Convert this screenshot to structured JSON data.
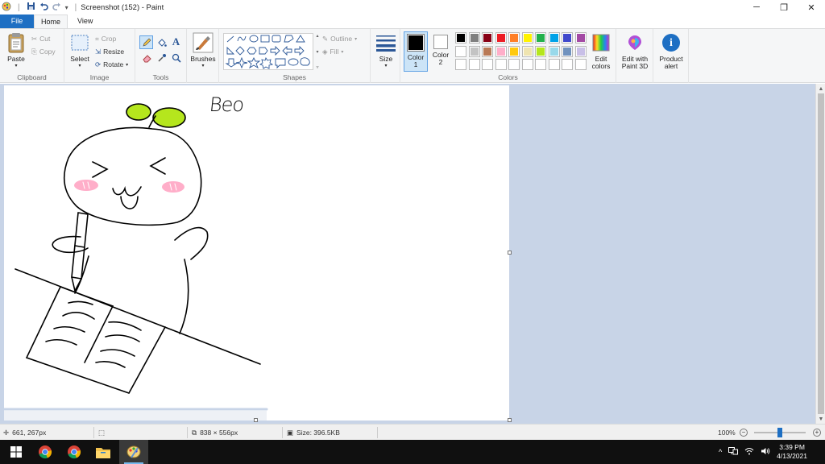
{
  "window": {
    "title": "Screenshot (152) - Paint",
    "qa_separator": "|",
    "qa_dropdown": "▾",
    "minimize": "─",
    "restore": "❐",
    "close": "✕",
    "collapse": "^"
  },
  "tabs": {
    "file": "File",
    "home": "Home",
    "view": "View",
    "help": "?"
  },
  "ribbon": {
    "clipboard": {
      "label": "Clipboard",
      "paste": "Paste",
      "cut": "Cut",
      "copy": "Copy"
    },
    "image": {
      "label": "Image",
      "select": "Select",
      "crop": "Crop",
      "resize": "Resize",
      "rotate": "Rotate"
    },
    "tools": {
      "label": "Tools",
      "text_icon": "A"
    },
    "brushes": {
      "label": "Brushes"
    },
    "shapes": {
      "label": "Shapes",
      "outline": "Outline",
      "fill": "Fill"
    },
    "size": {
      "label": "Size"
    },
    "color1": {
      "label": "Color 1",
      "value": "#000000"
    },
    "color2": {
      "label": "Color 2",
      "value": "#ffffff"
    },
    "colors": {
      "label": "Colors",
      "row1": [
        "#000000",
        "#7f7f7f",
        "#880015",
        "#ed1c24",
        "#ff7f27",
        "#fff200",
        "#22b14c",
        "#00a2e8",
        "#3f48cc",
        "#a349a4"
      ],
      "row2": [
        "#ffffff",
        "#c3c3c3",
        "#b97a57",
        "#ffaec9",
        "#ffc90e",
        "#efe4b0",
        "#b5e61d",
        "#99d9ea",
        "#7092be",
        "#c8bfe7"
      ],
      "row3_count": 10
    },
    "edit_colors": "Edit colors",
    "edit_paint3d": "Edit with Paint 3D",
    "product_alert": "Product alert",
    "product_alert_icon": "i"
  },
  "canvas": {
    "handwriting": "Beo"
  },
  "statusbar": {
    "cursor_pos": "661, 267px",
    "selection_size": "",
    "image_size": "838 × 556px",
    "file_size": "Size: 396.5KB",
    "zoom": "100%",
    "zoom_level": 0.5,
    "zoom_minus": "−",
    "zoom_plus": "+"
  },
  "taskbar": {
    "time": "3:39 PM",
    "date": "4/13/2021",
    "tray_chevron": "^"
  }
}
